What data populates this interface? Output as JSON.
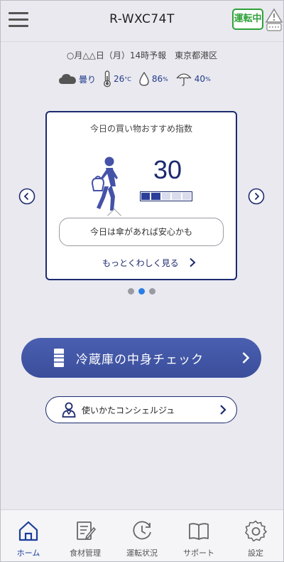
{
  "header": {
    "title": "R-WXC74T",
    "status_badge": "運転中",
    "icons": {
      "menu": "hamburger-menu-icon",
      "alert": "alert-device-icon"
    }
  },
  "weather": {
    "forecast_text": "○月△△日（月）14時予報　東京都港区",
    "condition": {
      "icon": "cloud-icon",
      "label": "曇り"
    },
    "temperature": {
      "icon": "thermometer-icon",
      "value": "26",
      "unit": "°C"
    },
    "humidity": {
      "icon": "drop-icon",
      "value": "86",
      "unit": "%"
    },
    "rain": {
      "icon": "umbrella-icon",
      "value": "40",
      "unit": "%"
    }
  },
  "card": {
    "title": "今日の買い物おすすめ指数",
    "index_value": "30",
    "index_level": 2,
    "index_max": 5,
    "message": "今日は傘があれば安心かも",
    "more_label": "もっとくわしく見る"
  },
  "carousel": {
    "pages": 3,
    "active_page": 2
  },
  "fridge_button": {
    "label": "冷蔵庫の中身チェック"
  },
  "guide_button": {
    "label": "使いかたコンシェルジュ"
  },
  "tabs": [
    {
      "label": "ホーム",
      "icon": "home-icon",
      "active": true
    },
    {
      "label": "食材管理",
      "icon": "notepad-icon",
      "active": false
    },
    {
      "label": "運転状況",
      "icon": "clock-icon",
      "active": false
    },
    {
      "label": "サポート",
      "icon": "book-icon",
      "active": false
    },
    {
      "label": "設定",
      "icon": "gear-icon",
      "active": false
    }
  ],
  "colors": {
    "accent": "#1c2a6e",
    "button": "#3f54a3",
    "status": "#2fa23a",
    "active_dot": "#2a7ee5"
  }
}
